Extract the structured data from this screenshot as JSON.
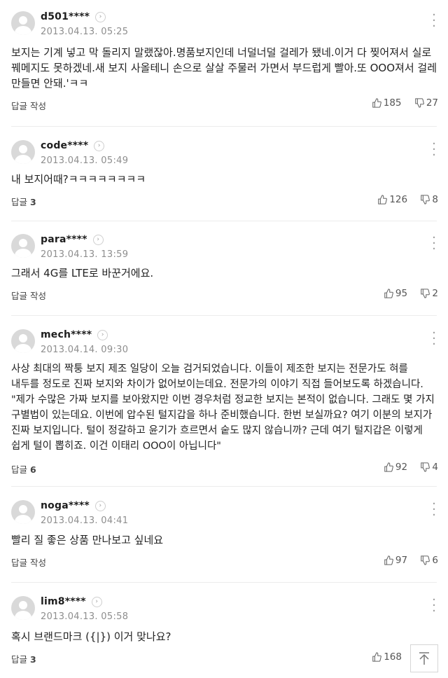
{
  "more_glyph": "⋮",
  "arrow_glyph": "›",
  "comments": [
    {
      "user": "d501****",
      "time": "2013.04.13. 05:25",
      "text": "보지는 기계 넣고 막 돌리지 말랬잖아.명품보지인데 너덜너덜 걸레가 됐네.이거 다 찢어져서 실로 꿰메지도 못하겠네.새 보지 사올테니 손으로 살살 주물러 가면서 부드럽게 빨아.또 OOO져서 걸레 만들면 안돼.'ㅋㅋ",
      "reply_label": "답글 작성",
      "reply_count": "",
      "likes": "185",
      "dislikes": "27"
    },
    {
      "user": "code****",
      "time": "2013.04.13. 05:49",
      "text": "내 보지어때?ㅋㅋㅋㅋㅋㅋㅋㅋ",
      "reply_label": "답글",
      "reply_count": "3",
      "likes": "126",
      "dislikes": "8"
    },
    {
      "user": "para****",
      "time": "2013.04.13. 13:59",
      "text": "그래서 4G를 LTE로 바꾼거에요.",
      "reply_label": "답글 작성",
      "reply_count": "",
      "likes": "95",
      "dislikes": "2"
    },
    {
      "user": "mech****",
      "time": "2013.04.14. 09:30",
      "text": "사상 최대의 짝퉁 보지 제조 일당이 오늘 검거되었습니다. 이들이 제조한 보지는 전문가도 혀를 내두를 정도로 진짜 보지와 차이가 없어보이는데요. 전문가의 이야기 직접 들어보도록 하겠습니다. \"제가 수많은 가짜 보지를 보아왔지만 이번 경우처럼 정교한 보지는 본적이 없습니다. 그래도 몇 가지 구별법이 있는데요. 이번에 압수된 털지갑을 하나 준비했습니다. 한번 보실까요? 여기 이분의 보지가 진짜 보지입니다. 털이 정갈하고 윤기가 흐르면서 숱도 많지 않습니까? 근데 여기 털지갑은 이렇게 쉽게 털이 뽑히죠. 이건 이태리 OOO이 아닙니다\"",
      "reply_label": "답글",
      "reply_count": "6",
      "likes": "92",
      "dislikes": "4"
    },
    {
      "user": "noga****",
      "time": "2013.04.13. 04:41",
      "text": "빨리 질 좋은 상품 만나보고 싶네요",
      "reply_label": "답글 작성",
      "reply_count": "",
      "likes": "97",
      "dislikes": "6"
    },
    {
      "user": "lim8****",
      "time": "2013.04.13. 05:58",
      "text": "혹시 브랜드마크 ({|}) 이거 맞나요?",
      "reply_label": "답글",
      "reply_count": "3",
      "likes": "168",
      "dislikes": ""
    }
  ]
}
